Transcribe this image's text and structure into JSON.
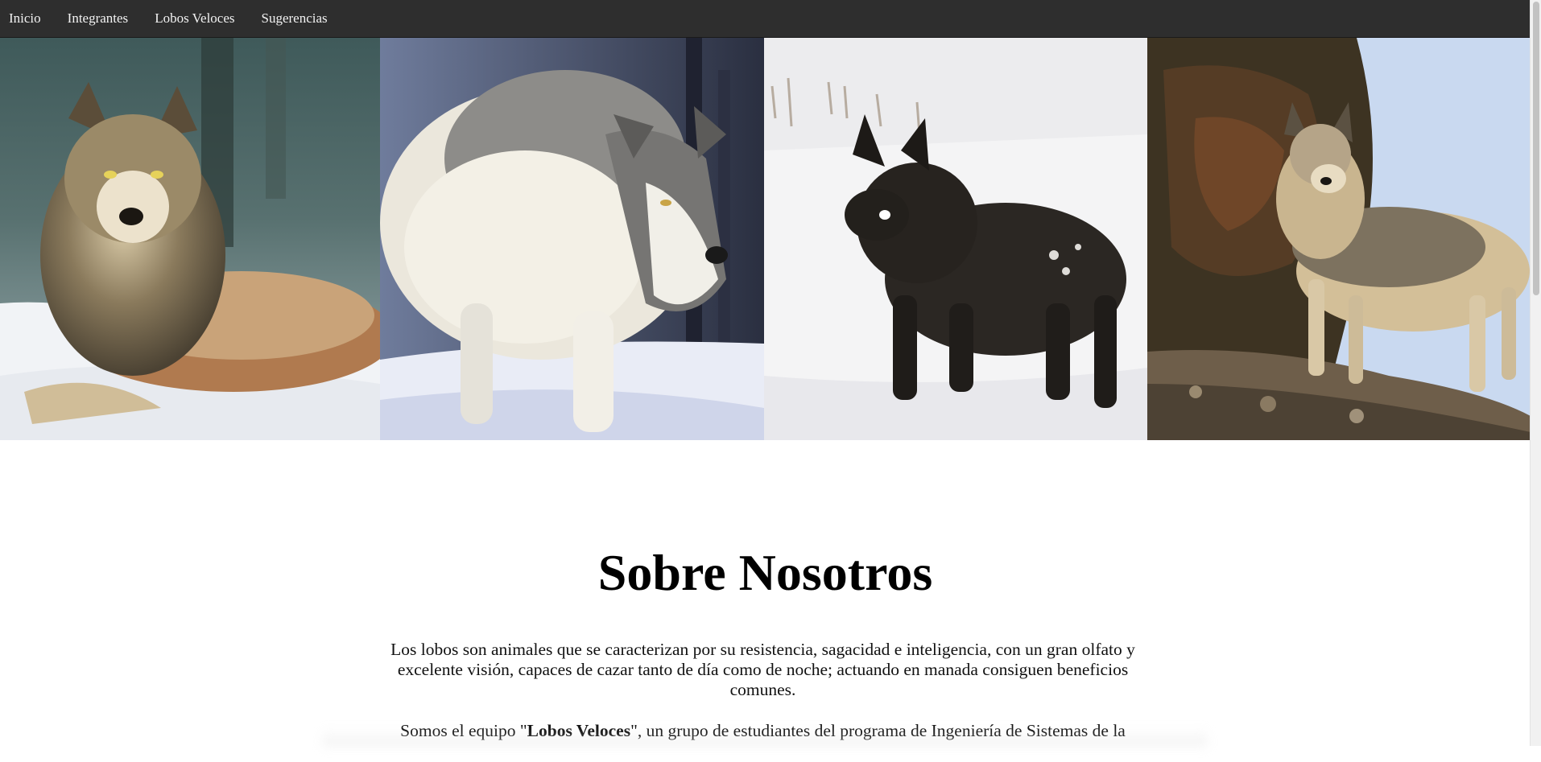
{
  "nav": {
    "links": [
      "Inicio",
      "Integrantes",
      "Lobos Veloces",
      "Sugerencias"
    ]
  },
  "gallery": {
    "photos": [
      {
        "icon": "wolf-lying-in-snow-icon"
      },
      {
        "icon": "white-wolf-walking-icon"
      },
      {
        "icon": "black-wolf-in-snow-icon"
      },
      {
        "icon": "gray-wolf-on-rock-icon"
      }
    ]
  },
  "about": {
    "title": "Sobre Nosotros",
    "paragraph1": "Los lobos son animales que se caracterizan por su resistencia, sagacidad e inteligencia, con un gran olfato y excelente visión, capaces de cazar tanto de día como de noche; actuando en manada consiguen beneficios comunes.",
    "paragraph2_before": "Somos el equipo \"",
    "paragraph2_bold": "Lobos Veloces",
    "paragraph2_after": "\", un grupo de estudiantes del programa de Ingeniería de Sistemas de la"
  },
  "colors": {
    "navbar_bg": "#2e2e2e",
    "nav_text": "#f2f2f2",
    "page_bg": "#ffffff"
  }
}
